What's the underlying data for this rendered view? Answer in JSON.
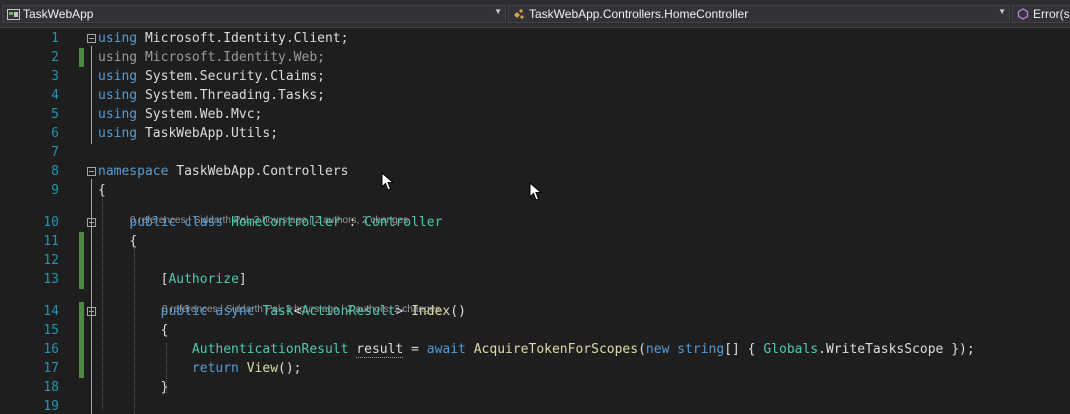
{
  "navigation": {
    "project": "TaskWebApp",
    "class_scope": "TaskWebApp.Controllers.HomeController",
    "member_scope": "Error(s"
  },
  "code": {
    "lines": [
      {
        "n": "1"
      },
      {
        "n": "2"
      },
      {
        "n": "3"
      },
      {
        "n": "4"
      },
      {
        "n": "5"
      },
      {
        "n": "6"
      },
      {
        "n": "7"
      },
      {
        "n": "8"
      },
      {
        "n": "9"
      },
      {
        "n": "10"
      },
      {
        "n": "11"
      },
      {
        "n": "12"
      },
      {
        "n": "13"
      },
      {
        "n": "14"
      },
      {
        "n": "15"
      },
      {
        "n": "16"
      },
      {
        "n": "17"
      },
      {
        "n": "18"
      },
      {
        "n": "19"
      }
    ],
    "tokens": {
      "using": "using",
      "ns1": "Microsoft.Identity.Client;",
      "ns2": "Microsoft.Identity.Web;",
      "ns3": "System.Security.Claims;",
      "ns4": "System.Threading.Tasks;",
      "ns5": "System.Web.Mvc;",
      "ns6": "TaskWebApp.Utils;",
      "namespace_kw": "namespace",
      "namespace_name": "TaskWebApp.Controllers",
      "open_brace": "{",
      "close_brace": "}",
      "public": "public",
      "class": "class",
      "class_name": "HomeController",
      "colon": ":",
      "base_class": "Controller",
      "attr_open": "[",
      "attr_name": "Authorize",
      "attr_close": "]",
      "async": "async",
      "task_type": "Task",
      "lt": "<",
      "action_result": "ActionResult",
      "gt": ">",
      "method_name": "Index",
      "parens": "()",
      "auth_result_type": "AuthenticationResult",
      "result_var": "result",
      "assign": "=",
      "await": "await",
      "acquire_fn": "AcquireTokenForScopes",
      "paren_open": "(",
      "new": "new",
      "string": "string",
      "array_open": "[] {",
      "globals": "Globals",
      "scope_member": ".WriteTasksScope",
      "call_close": "});",
      "return": "return",
      "view_fn": "View",
      "view_call_end": "();"
    },
    "codelens": {
      "class_lens": "0 references | Siddarth Pal, 3 hours ago | 2 authors, 2 changes",
      "method_lens": "0 references | Siddarth Pal, 3 hours ago | 2 authors, 2 changes"
    }
  },
  "colors": {
    "keyword": "#569cd6",
    "type": "#4ec9b0",
    "method": "#dcdcaa",
    "line_number": "#2b91af",
    "change_bar": "#57a64a"
  }
}
